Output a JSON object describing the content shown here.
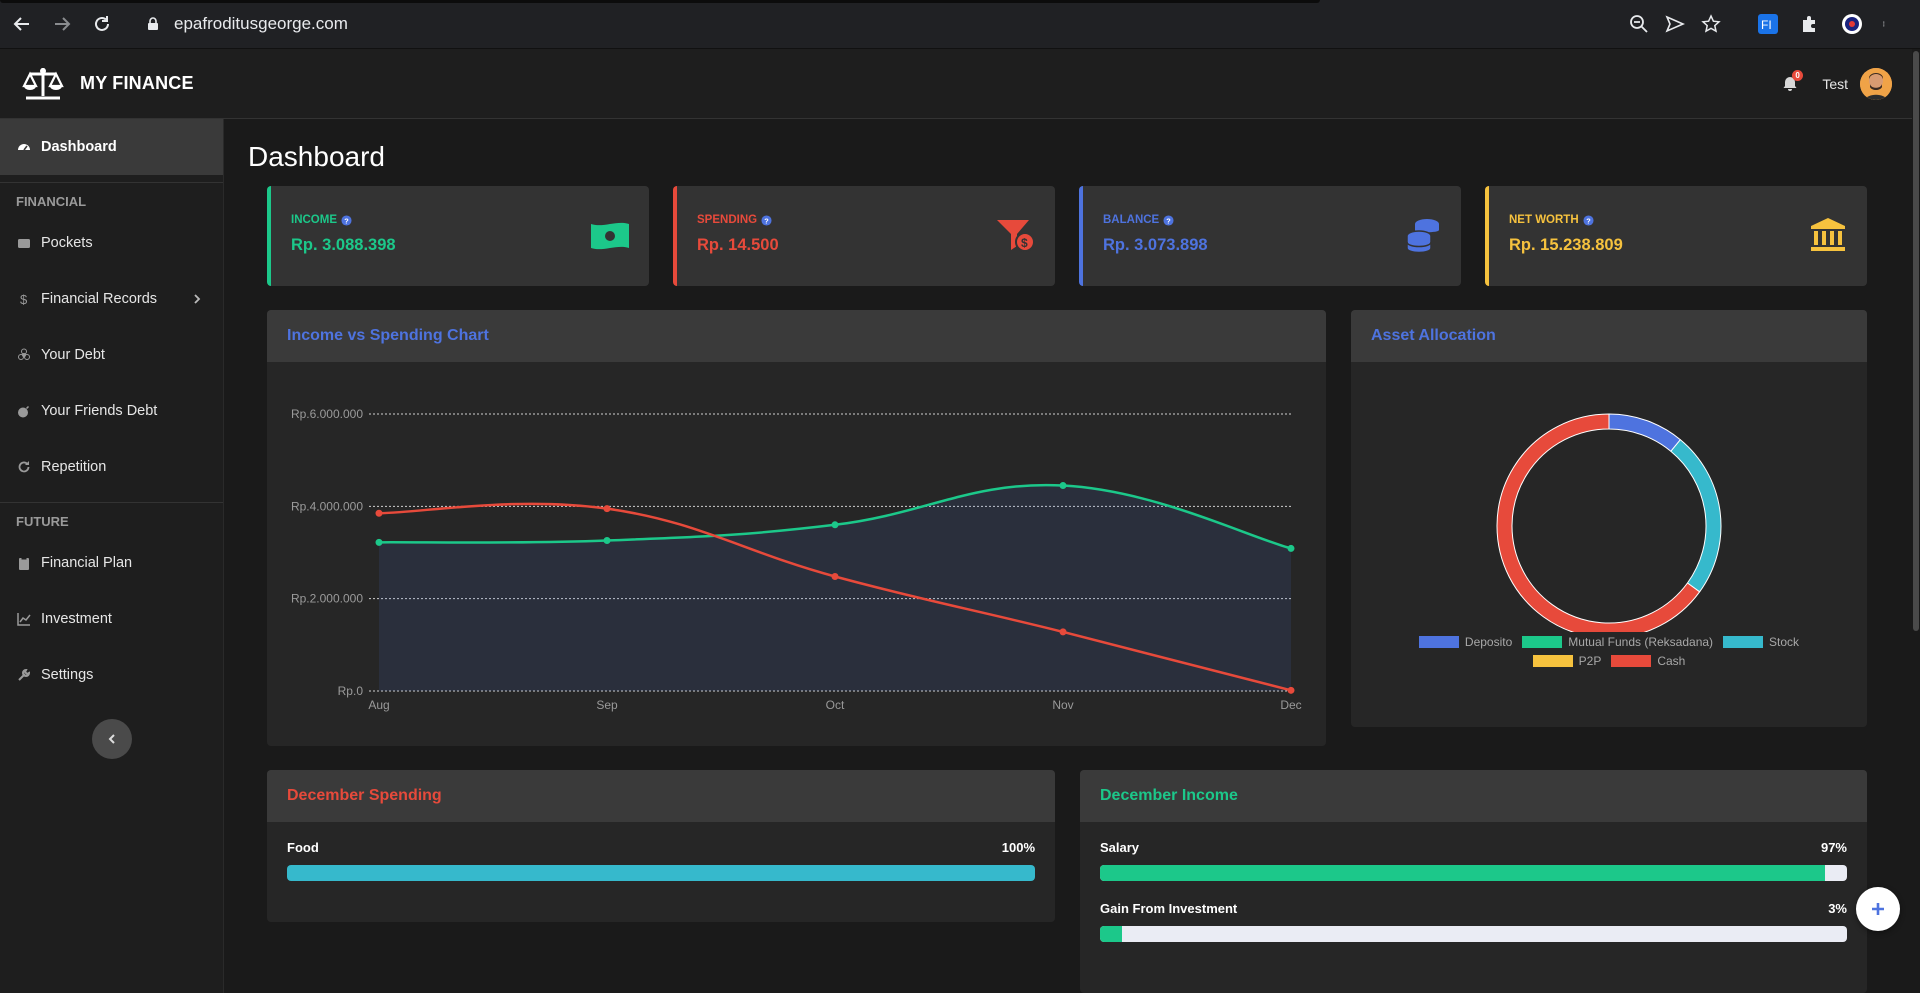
{
  "browser": {
    "url": "epafroditusgeorge.com"
  },
  "header": {
    "brand": "MY FINANCE",
    "notification_count": "0",
    "user_name": "Test"
  },
  "sidebar": {
    "dashboard": "Dashboard",
    "section_financial": "FINANCIAL",
    "pockets": "Pockets",
    "financial_records": "Financial Records",
    "your_debt": "Your Debt",
    "friends_debt": "Your Friends Debt",
    "repetition": "Repetition",
    "section_future": "FUTURE",
    "financial_plan": "Financial Plan",
    "investment": "Investment",
    "settings": "Settings"
  },
  "page": {
    "title": "Dashboard"
  },
  "cards": {
    "income": {
      "label": "INCOME",
      "value": "Rp. 3.088.398",
      "color": "#1cc88a"
    },
    "spending": {
      "label": "SPENDING",
      "value": "Rp. 14.500",
      "color": "#e74a3b"
    },
    "balance": {
      "label": "BALANCE",
      "value": "Rp. 3.073.898",
      "color": "#4e73df"
    },
    "net_worth": {
      "label": "NET WORTH",
      "value": "Rp. 15.238.809",
      "color": "#f6c23e"
    }
  },
  "income_chart": {
    "title": "Income vs Spending Chart"
  },
  "asset_panel": {
    "title": "Asset Allocation"
  },
  "chart_data": [
    {
      "type": "line",
      "title": "Income vs Spending Chart",
      "x": [
        "Aug",
        "Sep",
        "Oct",
        "Nov",
        "Dec"
      ],
      "y_ticks": [
        "Rp.0",
        "Rp.2.000.000",
        "Rp.4.000.000",
        "Rp.6.000.000"
      ],
      "ylim": [
        0,
        6000000
      ],
      "series": [
        {
          "color": "#1cc88a",
          "values": [
            3220000,
            3260000,
            3600000,
            4450000,
            3088398
          ],
          "fill": true
        },
        {
          "color": "#e74a3b",
          "values": [
            3850000,
            3950000,
            2480000,
            1280000,
            14500
          ]
        }
      ]
    },
    {
      "type": "pie",
      "title": "Asset Allocation",
      "labels": [
        "Deposito",
        "Mutual Funds (Reksadana)",
        "Stock",
        "P2P",
        "Cash"
      ],
      "colors": [
        "#4e73df",
        "#1cc88a",
        "#36b9cc",
        "#f6c23e",
        "#e74a3b"
      ],
      "values": [
        11,
        0,
        24,
        0,
        65
      ],
      "legend_position": "bottom"
    }
  ],
  "december_spending": {
    "title": "December Spending",
    "items": [
      {
        "label": "Food",
        "percent_label": "100%",
        "percent": 100,
        "color": "#36b9cc"
      }
    ]
  },
  "december_income": {
    "title": "December Income",
    "items": [
      {
        "label": "Salary",
        "percent_label": "97%",
        "percent": 97,
        "color": "#1cc88a"
      },
      {
        "label": "Gain From Investment",
        "percent_label": "3%",
        "percent": 3,
        "color": "#1cc88a"
      }
    ]
  }
}
